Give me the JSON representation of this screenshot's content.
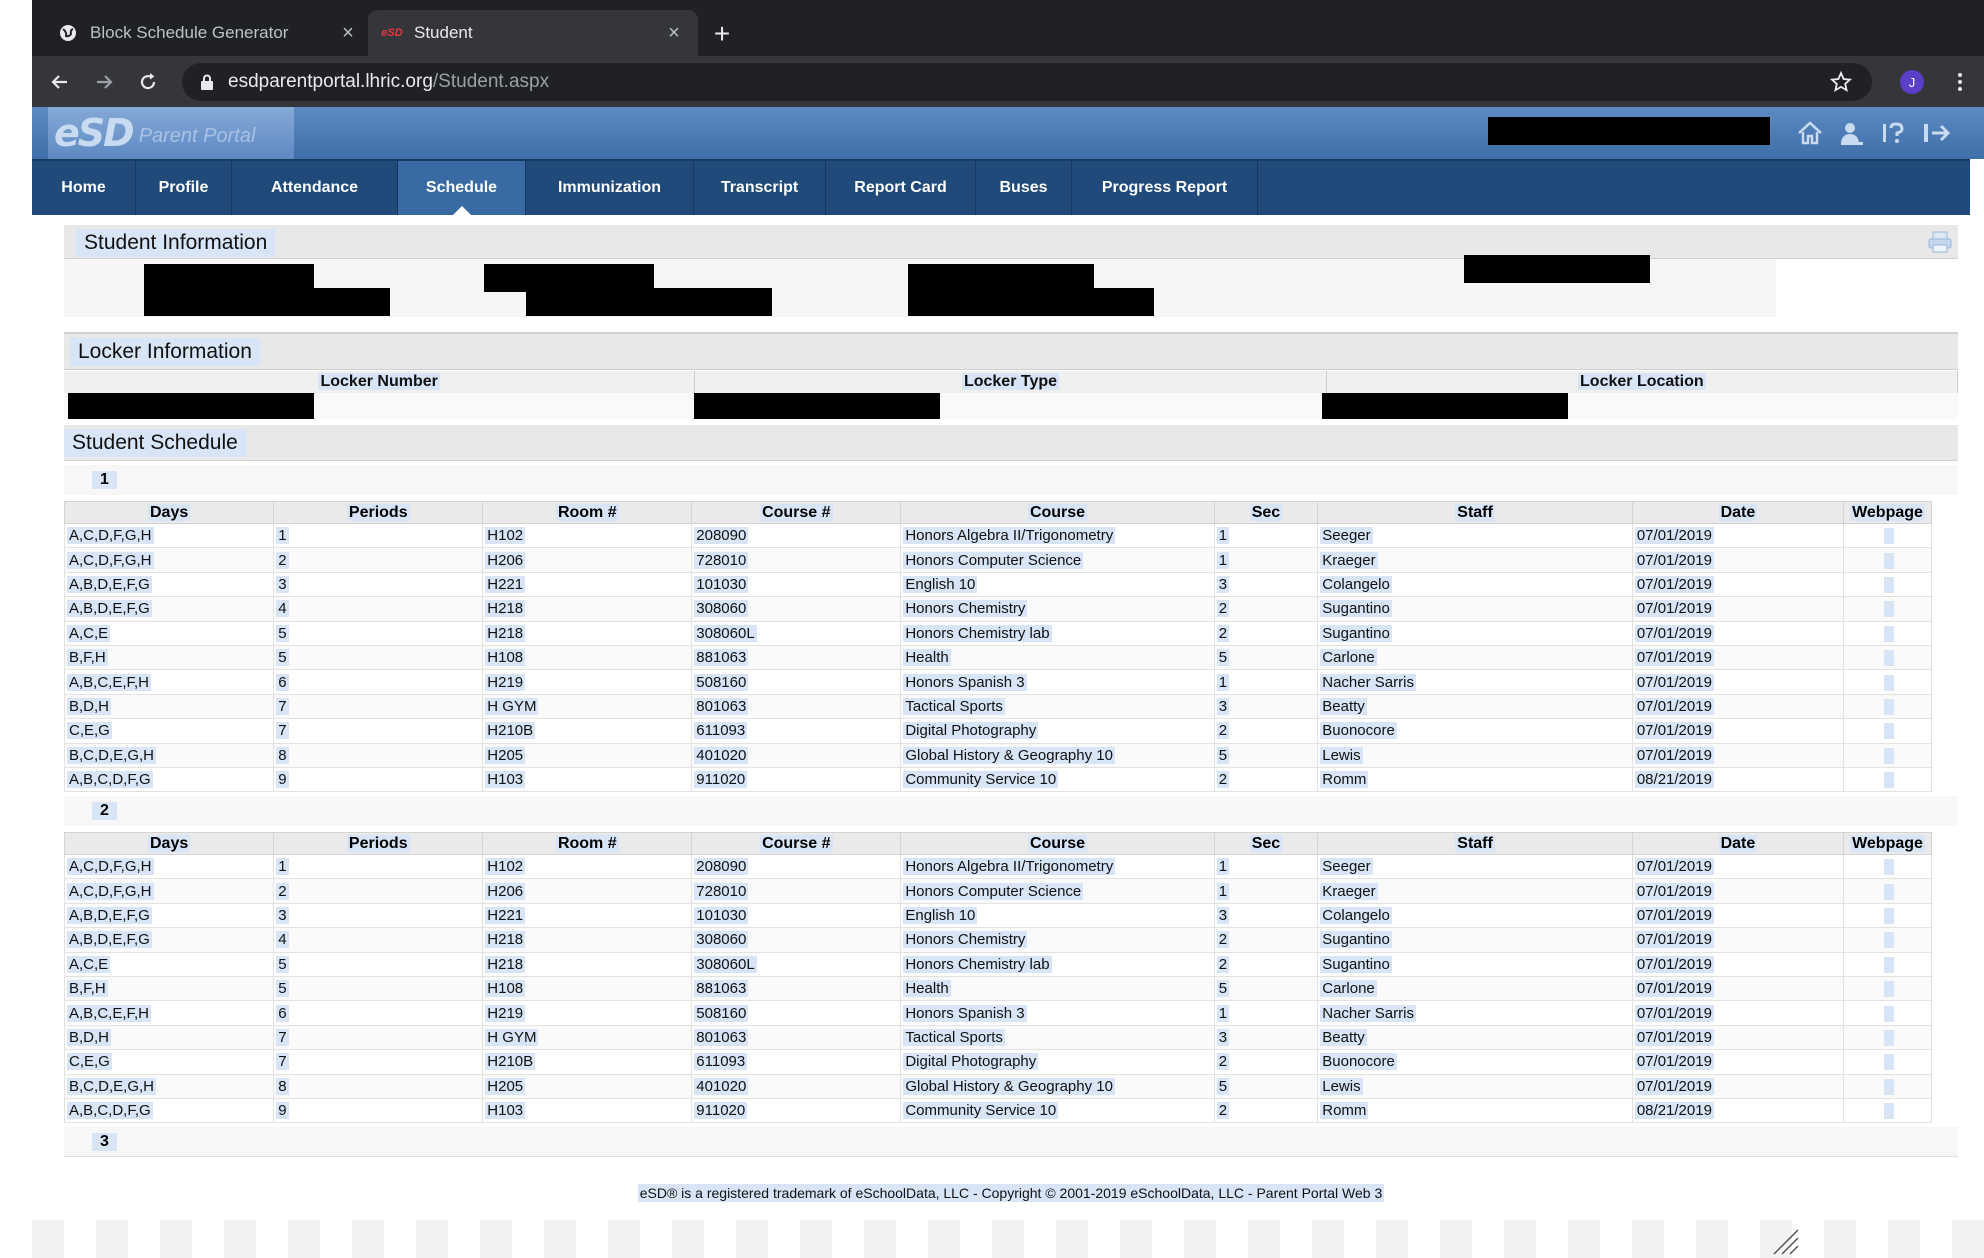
{
  "browser": {
    "tabs": [
      {
        "title": "Block Schedule Generator",
        "favicon": "globe-icon"
      },
      {
        "title": "Student",
        "favicon": "esd-favicon",
        "favicon_text": "eSD"
      }
    ],
    "url_host": "esdparentportal.lhric.org",
    "url_path": "/Student.aspx",
    "profile_initial": "J"
  },
  "portal": {
    "logo_mark": "eSD",
    "logo_sub": "Parent Portal",
    "nav": [
      {
        "label": "Home",
        "active": false
      },
      {
        "label": "Profile",
        "active": false
      },
      {
        "label": "Attendance",
        "active": false
      },
      {
        "label": "Schedule",
        "active": true
      },
      {
        "label": "Immunization",
        "active": false
      },
      {
        "label": "Transcript",
        "active": false
      },
      {
        "label": "Report Card",
        "active": false
      },
      {
        "label": "Buses",
        "active": false
      },
      {
        "label": "Progress Report",
        "active": false
      }
    ]
  },
  "sections": {
    "student_info": "Student Information",
    "locker_info": "Locker Information",
    "student_schedule": "Student Schedule"
  },
  "locker": {
    "headers": [
      "Locker Number",
      "Locker Type",
      "Locker Location"
    ]
  },
  "schedule": {
    "headers": [
      "Days",
      "Periods",
      "Room #",
      "Course #",
      "Course",
      "Sec",
      "Staff",
      "Date",
      "Webpage"
    ],
    "terms": [
      {
        "label": "1",
        "rows": [
          [
            "A,C,D,F,G,H",
            "1",
            "H102",
            "208090",
            "Honors Algebra II/Trigonometry",
            "1",
            "Seeger",
            "07/01/2019"
          ],
          [
            "A,C,D,F,G,H",
            "2",
            "H206",
            "728010",
            "Honors Computer Science",
            "1",
            "Kraeger",
            "07/01/2019"
          ],
          [
            "A,B,D,E,F,G",
            "3",
            "H221",
            "101030",
            "English 10",
            "3",
            "Colangelo",
            "07/01/2019"
          ],
          [
            "A,B,D,E,F,G",
            "4",
            "H218",
            "308060",
            "Honors Chemistry",
            "2",
            "Sugantino",
            "07/01/2019"
          ],
          [
            "A,C,E",
            "5",
            "H218",
            "308060L",
            "Honors Chemistry lab",
            "2",
            "Sugantino",
            "07/01/2019"
          ],
          [
            "B,F,H",
            "5",
            "H108",
            "881063",
            "Health",
            "5",
            "Carlone",
            "07/01/2019"
          ],
          [
            "A,B,C,E,F,H",
            "6",
            "H219",
            "508160",
            "Honors Spanish 3",
            "1",
            "Nacher Sarris",
            "07/01/2019"
          ],
          [
            "B,D,H",
            "7",
            "H GYM",
            "801063",
            "Tactical Sports",
            "3",
            "Beatty",
            "07/01/2019"
          ],
          [
            "C,E,G",
            "7",
            "H210B",
            "611093",
            "Digital Photography",
            "2",
            "Buonocore",
            "07/01/2019"
          ],
          [
            "B,C,D,E,G,H",
            "8",
            "H205",
            "401020",
            "Global History & Geography 10",
            "5",
            "Lewis",
            "07/01/2019"
          ],
          [
            "A,B,C,D,F,G",
            "9",
            "H103",
            "911020",
            "Community Service 10",
            "2",
            "Romm",
            "08/21/2019"
          ]
        ]
      },
      {
        "label": "2",
        "rows": [
          [
            "A,C,D,F,G,H",
            "1",
            "H102",
            "208090",
            "Honors Algebra II/Trigonometry",
            "1",
            "Seeger",
            "07/01/2019"
          ],
          [
            "A,C,D,F,G,H",
            "2",
            "H206",
            "728010",
            "Honors Computer Science",
            "1",
            "Kraeger",
            "07/01/2019"
          ],
          [
            "A,B,D,E,F,G",
            "3",
            "H221",
            "101030",
            "English 10",
            "3",
            "Colangelo",
            "07/01/2019"
          ],
          [
            "A,B,D,E,F,G",
            "4",
            "H218",
            "308060",
            "Honors Chemistry",
            "2",
            "Sugantino",
            "07/01/2019"
          ],
          [
            "A,C,E",
            "5",
            "H218",
            "308060L",
            "Honors Chemistry lab",
            "2",
            "Sugantino",
            "07/01/2019"
          ],
          [
            "B,F,H",
            "5",
            "H108",
            "881063",
            "Health",
            "5",
            "Carlone",
            "07/01/2019"
          ],
          [
            "A,B,C,E,F,H",
            "6",
            "H219",
            "508160",
            "Honors Spanish 3",
            "1",
            "Nacher Sarris",
            "07/01/2019"
          ],
          [
            "B,D,H",
            "7",
            "H GYM",
            "801063",
            "Tactical Sports",
            "3",
            "Beatty",
            "07/01/2019"
          ],
          [
            "C,E,G",
            "7",
            "H210B",
            "611093",
            "Digital Photography",
            "2",
            "Buonocore",
            "07/01/2019"
          ],
          [
            "B,C,D,E,G,H",
            "8",
            "H205",
            "401020",
            "Global History & Geography 10",
            "5",
            "Lewis",
            "07/01/2019"
          ],
          [
            "A,B,C,D,F,G",
            "9",
            "H103",
            "911020",
            "Community Service 10",
            "2",
            "Romm",
            "08/21/2019"
          ]
        ]
      },
      {
        "label": "3",
        "rows": []
      }
    ]
  },
  "footer": "eSD® is a registered trademark of eSchoolData, LLC - Copyright © 2001-2019 eSchoolData, LLC - Parent Portal Web 3",
  "colors": {
    "nav_bg": "#1f4a7a",
    "nav_active": "#3a6aa4",
    "header_blue": "#4f7db7",
    "highlight": "#d7e5f7"
  }
}
